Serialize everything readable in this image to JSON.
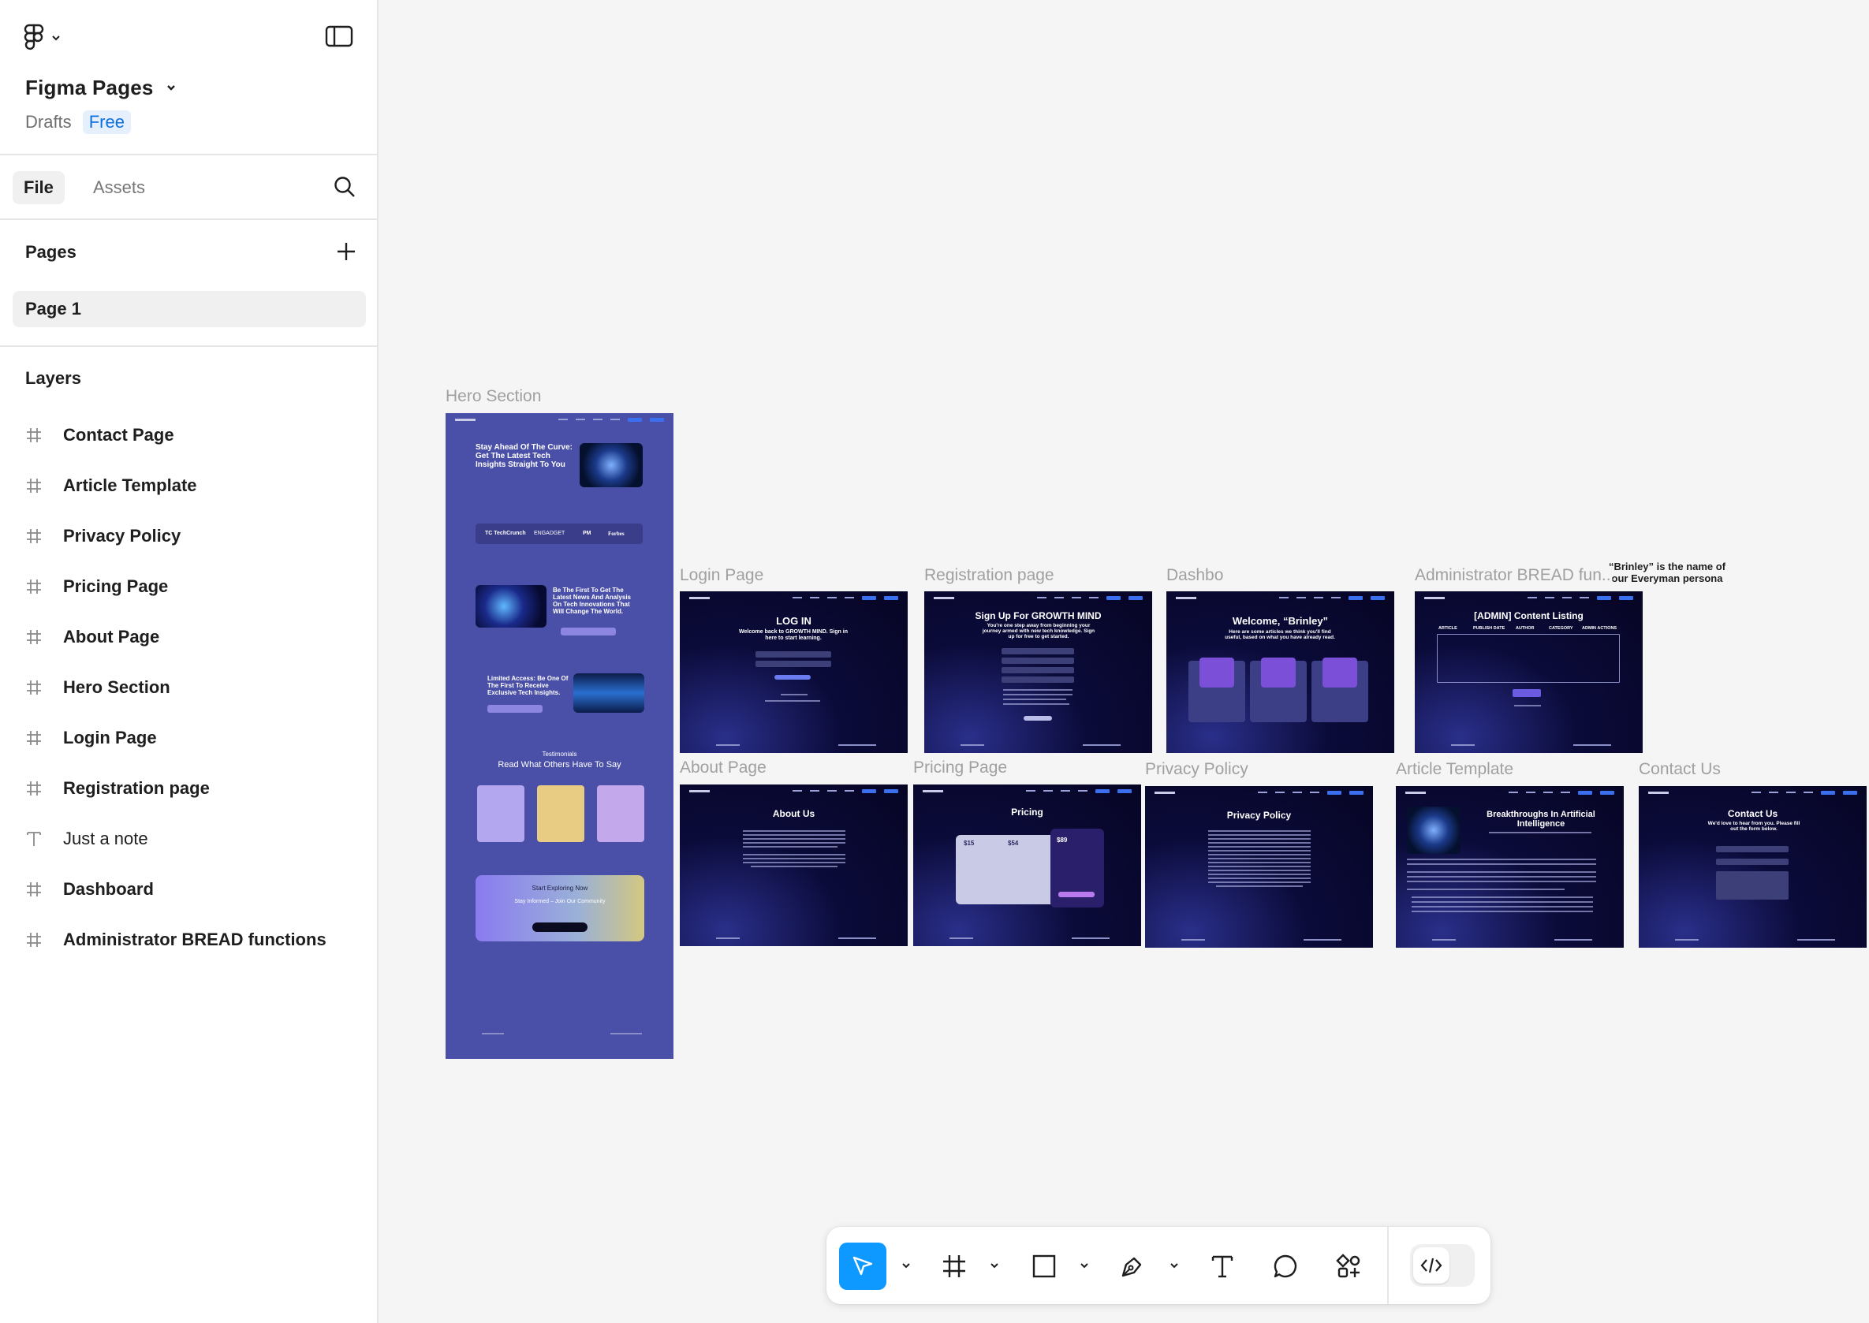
{
  "file": {
    "name": "Figma Pages",
    "location": "Drafts",
    "plan": "Free"
  },
  "tabs": {
    "file": "File",
    "assets": "Assets"
  },
  "pages": {
    "heading": "Pages",
    "items": [
      "Page 1"
    ]
  },
  "layers": {
    "heading": "Layers",
    "items": [
      {
        "name": "Contact Page",
        "type": "frame"
      },
      {
        "name": "Article Template",
        "type": "frame"
      },
      {
        "name": "Privacy Policy",
        "type": "frame"
      },
      {
        "name": "Pricing Page",
        "type": "frame"
      },
      {
        "name": "About Page",
        "type": "frame"
      },
      {
        "name": "Hero Section",
        "type": "frame"
      },
      {
        "name": "Login Page",
        "type": "frame"
      },
      {
        "name": "Registration page",
        "type": "frame"
      },
      {
        "name": "Just a note",
        "type": "text"
      },
      {
        "name": "Dashboard",
        "type": "frame"
      },
      {
        "name": "Administrator BREAD functions",
        "type": "frame"
      }
    ]
  },
  "canvas": {
    "labels": {
      "hero": "Hero Section",
      "login": "Login Page",
      "registration": "Registration page",
      "dashboard": "Dashbo",
      "admin": "Administrator BREAD fun...",
      "about": "About Page",
      "pricing": "Pricing Page",
      "privacy": "Privacy Policy",
      "article": "Article Template",
      "contact": "Contact Us"
    },
    "note": "“Brinley” is the name of our Everyman persona",
    "frames_text": {
      "hero_headline": "Stay Ahead Of The Curve: Get The Latest Tech Insights Straight To You",
      "hero_logos": [
        "TC TechCrunch",
        "ENGADGET",
        "PM",
        "Forbes"
      ],
      "hero_feature1": "Be The First To Get The Latest News And Analysis On Tech Innovations That Will Change The World.",
      "hero_feature2": "Limited Access: Be One Of The First To Receive Exclusive Tech Insights.",
      "hero_testimonials_kicker": "Testimonials",
      "hero_testimonials_title": "Read What Others Have To Say",
      "hero_cta_title": "Start Exploring Now",
      "hero_cta_sub": "Stay Informed – Join Our Community",
      "login_title": "LOG IN",
      "login_sub": "Welcome back to GROWTH MIND. Sign in here to start learning.",
      "reg_title": "Sign Up For GROWTH MIND",
      "reg_sub": "You're one step away from beginning your journey armed with new tech knowledge. Sign up for free to get started.",
      "dash_title": "Welcome, “Brinley”",
      "dash_sub": "Here are some articles we think you'll find useful, based on what you have already read.",
      "admin_title": "[ADMIN] Content Listing",
      "admin_cols": [
        "ARTICLE",
        "PUBLISH DATE",
        "AUTHOR",
        "CATEGORY",
        "ADMIN ACTIONS"
      ],
      "about_title": "About Us",
      "pricing_title": "Pricing",
      "pricing_prices": [
        "$15",
        "$54",
        "$89"
      ],
      "privacy_title": "Privacy Policy",
      "article_title": "Breakthroughs In Artificial Intelligence",
      "contact_title": "Contact Us",
      "contact_sub": "We'd love to hear from you. Please fill out the form below."
    }
  },
  "toolbar": {
    "tools": [
      "move",
      "frame",
      "shape",
      "pen",
      "text",
      "comment",
      "actions"
    ],
    "active": "move",
    "dev_mode": false
  }
}
